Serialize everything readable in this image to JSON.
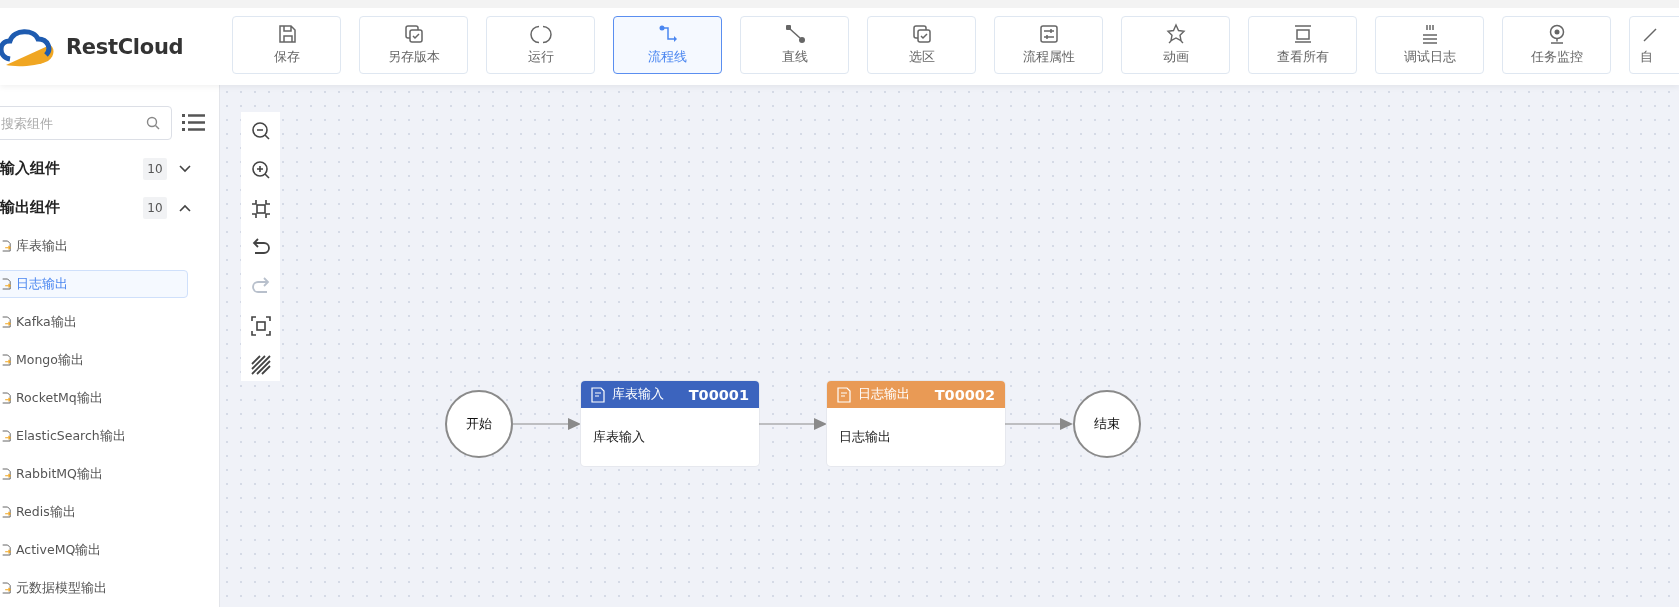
{
  "logo": {
    "text": "RestCloud"
  },
  "toolbar": [
    {
      "label": "保存",
      "selected": false
    },
    {
      "label": "另存版本",
      "selected": false
    },
    {
      "label": "运行",
      "selected": false
    },
    {
      "label": "流程线",
      "selected": true
    },
    {
      "label": "直线",
      "selected": false
    },
    {
      "label": "选区",
      "selected": false
    },
    {
      "label": "流程属性",
      "selected": false
    },
    {
      "label": "动画",
      "selected": false
    },
    {
      "label": "查看所有",
      "selected": false
    },
    {
      "label": "调试日志",
      "selected": false
    },
    {
      "label": "任务监控",
      "selected": false
    },
    {
      "label": "自",
      "selected": false
    }
  ],
  "sidebar": {
    "search": {
      "placeholder": "搜索组件"
    },
    "groups": [
      {
        "title": "输入组件",
        "count": "10",
        "expanded": false
      },
      {
        "title": "输出组件",
        "count": "10",
        "expanded": true,
        "items": [
          {
            "label": "库表输出",
            "selected": false
          },
          {
            "label": "日志输出",
            "selected": true
          },
          {
            "label": "Kafka输出",
            "selected": false
          },
          {
            "label": "Mongo输出",
            "selected": false
          },
          {
            "label": "RocketMq输出",
            "selected": false
          },
          {
            "label": "ElasticSearch输出",
            "selected": false
          },
          {
            "label": "RabbitMQ输出",
            "selected": false
          },
          {
            "label": "Redis输出",
            "selected": false
          },
          {
            "label": "ActiveMQ输出",
            "selected": false
          },
          {
            "label": "元数据模型输出",
            "selected": false
          }
        ]
      }
    ]
  },
  "canvas_tools": [
    {
      "kind": "zoom-out",
      "disabled": false
    },
    {
      "kind": "zoom-in",
      "disabled": false
    },
    {
      "kind": "fit",
      "disabled": false
    },
    {
      "kind": "undo",
      "disabled": false
    },
    {
      "kind": "redo",
      "disabled": true
    },
    {
      "kind": "fullscreen",
      "disabled": false
    },
    {
      "kind": "grid",
      "disabled": false
    }
  ],
  "flow": {
    "nodes": [
      {
        "kind": "start",
        "label": "开始"
      },
      {
        "kind": "task",
        "title": "库表输入",
        "code": "T00001",
        "body": "库表输入",
        "color": "#3c64be"
      },
      {
        "kind": "task",
        "title": "日志输出",
        "code": "T00002",
        "body": "日志输出",
        "color": "#e99a55"
      },
      {
        "kind": "end",
        "label": "结束"
      }
    ]
  }
}
